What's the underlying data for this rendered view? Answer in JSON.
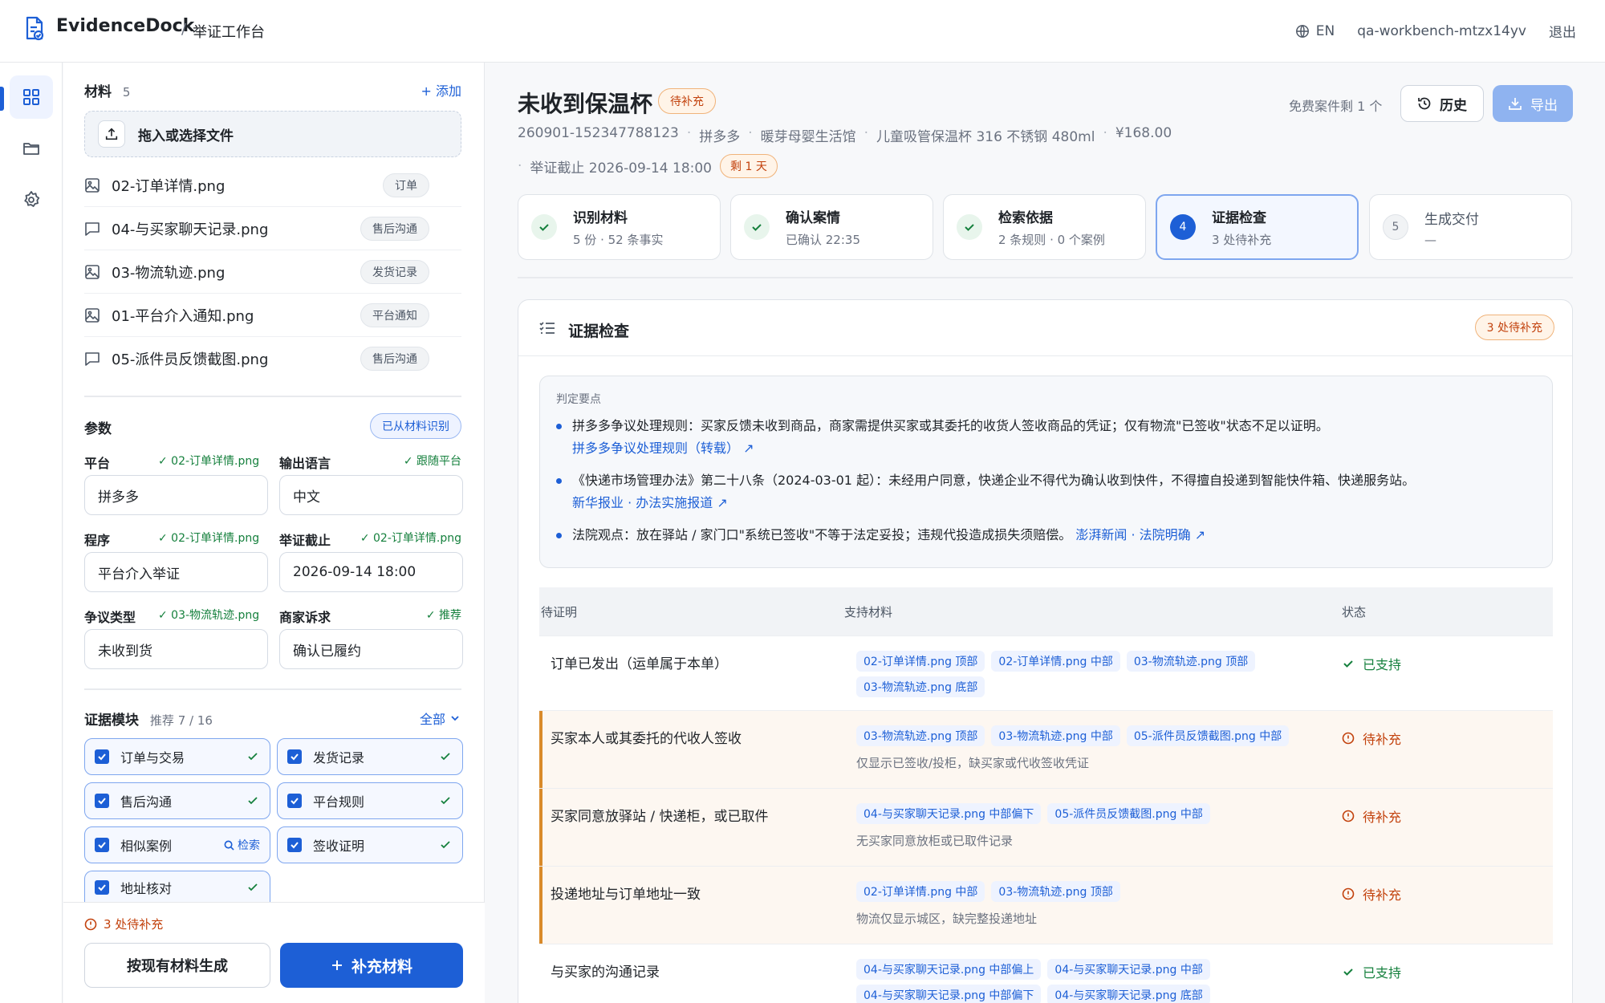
{
  "app": {
    "brand": "EvidenceDock",
    "separator": "/",
    "workspace": "举证工作台"
  },
  "topbar": {
    "lang": "EN",
    "user": "qa-workbench-mtzx14yv",
    "logout": "退出"
  },
  "materials": {
    "title": "材料",
    "count": "5",
    "add": "+ 添加",
    "drop": "拖入或选择文件",
    "files": [
      {
        "name": "02-订单详情.png",
        "tag": "订单",
        "icon": "image-icon"
      },
      {
        "name": "04-与买家聊天记录.png",
        "tag": "售后沟通",
        "icon": "chat-icon"
      },
      {
        "name": "03-物流轨迹.png",
        "tag": "发货记录",
        "icon": "image-icon"
      },
      {
        "name": "01-平台介入通知.png",
        "tag": "平台通知",
        "icon": "image-icon"
      },
      {
        "name": "05-派件员反馈截图.png",
        "tag": "售后沟通",
        "icon": "chat-icon"
      }
    ]
  },
  "params": {
    "title": "参数",
    "badge": "已从材料识别",
    "fields": [
      {
        "label": "平台",
        "source": "✓ 02-订单详情.png",
        "value": "拼多多"
      },
      {
        "label": "输出语言",
        "source": "✓ 跟随平台",
        "value": "中文"
      },
      {
        "label": "程序",
        "source": "✓ 02-订单详情.png",
        "value": "平台介入举证"
      },
      {
        "label": "举证截止",
        "source": "✓ 02-订单详情.png",
        "value": "2026-09-14 18:00"
      },
      {
        "label": "争议类型",
        "source": "✓ 03-物流轨迹.png",
        "value": "未收到货"
      },
      {
        "label": "商家诉求",
        "source": "✓ 推荐",
        "value": "确认已履约"
      }
    ]
  },
  "modules": {
    "title": "证据模块",
    "sub": "推荐 7 / 16",
    "all": "全部",
    "items": [
      "订单与交易",
      "发货记录",
      "售后沟通",
      "平台规则",
      "相似案例",
      "签收证明",
      "地址核对"
    ],
    "search": "检索"
  },
  "footer": {
    "pending": "3 处待补充",
    "gen": "按现有材料生成",
    "supplement": "补充材料"
  },
  "case": {
    "title": "未收到保温杯",
    "status": "待补充",
    "meta": [
      "260901-152347788123",
      "拼多多",
      "暖芽母婴生活馆",
      "儿童吸管保温杯 316 不锈钢 480ml",
      "¥168.00"
    ],
    "deadline": "举证截止  2026-09-14 18:00",
    "remaining": "剩 1 天",
    "free": "免费案件剩 1 个",
    "history": "历史",
    "export": "导出"
  },
  "steps": [
    {
      "title": "识别材料",
      "sub": "5 份 · 52 条事实",
      "state": "done"
    },
    {
      "title": "确认案情",
      "sub": "已确认 22:35",
      "state": "done"
    },
    {
      "title": "检索依据",
      "sub": "2 条规则 · 0 个案例",
      "state": "done"
    },
    {
      "title": "证据检查",
      "sub": "3 处待补充",
      "state": "current",
      "num": "4"
    },
    {
      "title": "生成交付",
      "sub": "—",
      "state": "todo",
      "num": "5"
    }
  ],
  "check": {
    "title": "证据检查",
    "badge": "3 处待补充",
    "points_title": "判定要点",
    "points": [
      {
        "text": "拼多多争议处理规则：买家反馈未收到商品，商家需提供买家或其委托的收货人签收商品的凭证；仅有物流\"已签收\"状态不足以证明。",
        "link": "拼多多争议处理规则（转载） ↗"
      },
      {
        "text": "《快递市场管理办法》第二十八条（2024-03-01 起）：未经用户同意，快递企业不得代为确认收到快件，不得擅自投递到智能快件箱、快递服务站。",
        "link": "新华报业 · 办法实施报道 ↗"
      },
      {
        "text": "法院观点：放在驿站 / 家门口\"系统已签收\"不等于法定妥投；违规代投造成损失须赔偿。",
        "link": "澎湃新闻 · 法院明确 ↗"
      }
    ],
    "headers": [
      "待证明",
      "支持材料",
      "状态"
    ],
    "rows": [
      {
        "claim": "订单已发出（运单属于本单）",
        "chips": [
          "02-订单详情.png 顶部",
          "02-订单详情.png 中部",
          "03-物流轨迹.png 顶部",
          "03-物流轨迹.png 底部"
        ],
        "note": "",
        "status": "已支持",
        "ok": true
      },
      {
        "claim": "买家本人或其委托的代收人签收",
        "chips": [
          "03-物流轨迹.png 顶部",
          "03-物流轨迹.png 中部",
          "05-派件员反馈截图.png 中部"
        ],
        "note": "仅显示已签收/投柜，缺买家或代收签收凭证",
        "status": "待补充",
        "ok": false
      },
      {
        "claim": "买家同意放驿站 / 快递柜，或已取件",
        "chips": [
          "04-与买家聊天记录.png 中部偏下",
          "05-派件员反馈截图.png 中部"
        ],
        "note": "无买家同意放柜或已取件记录",
        "status": "待补充",
        "ok": false
      },
      {
        "claim": "投递地址与订单地址一致",
        "chips": [
          "02-订单详情.png 中部",
          "03-物流轨迹.png 顶部"
        ],
        "note": "物流仅显示城区，缺完整投递地址",
        "status": "待补充",
        "ok": false
      },
      {
        "claim": "与买家的沟通记录",
        "chips": [
          "04-与买家聊天记录.png 中部偏上",
          "04-与买家聊天记录.png 中部",
          "04-与买家聊天记录.png 中部偏下",
          "04-与买家聊天记录.png 底部"
        ],
        "note": "",
        "status": "已支持",
        "ok": true
      }
    ]
  },
  "colors": {
    "accent": "#1d5fd6",
    "success": "#15803d",
    "warning": "#c2410c"
  }
}
